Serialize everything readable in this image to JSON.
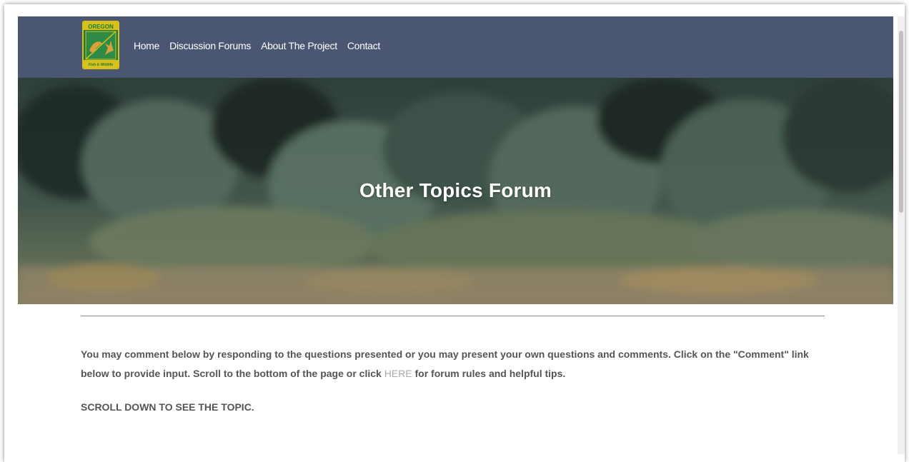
{
  "logo": {
    "top_text": "OREGON",
    "bottom_text": "Fish & Wildlife",
    "colors": {
      "border": "#d6c21a",
      "field": "#1f7a3a",
      "fish": "#d9a13b"
    }
  },
  "nav": {
    "items": [
      {
        "label": "Home"
      },
      {
        "label": "Discussion Forums"
      },
      {
        "label": "About The Project"
      },
      {
        "label": "Contact"
      }
    ],
    "background": "#4a5672"
  },
  "hero": {
    "title": "Other Topics Forum"
  },
  "intro": {
    "text_before": "You may comment below by responding to the questions presented or you may present your own questions and comments. Click on the \"Comment\" link below to provide input. Scroll to the bottom of the page or click ",
    "link_text": "HERE",
    "text_after": " for forum rules and helpful tips."
  },
  "scroll_note": "SCROLL DOWN TO SEE THE TOPIC."
}
